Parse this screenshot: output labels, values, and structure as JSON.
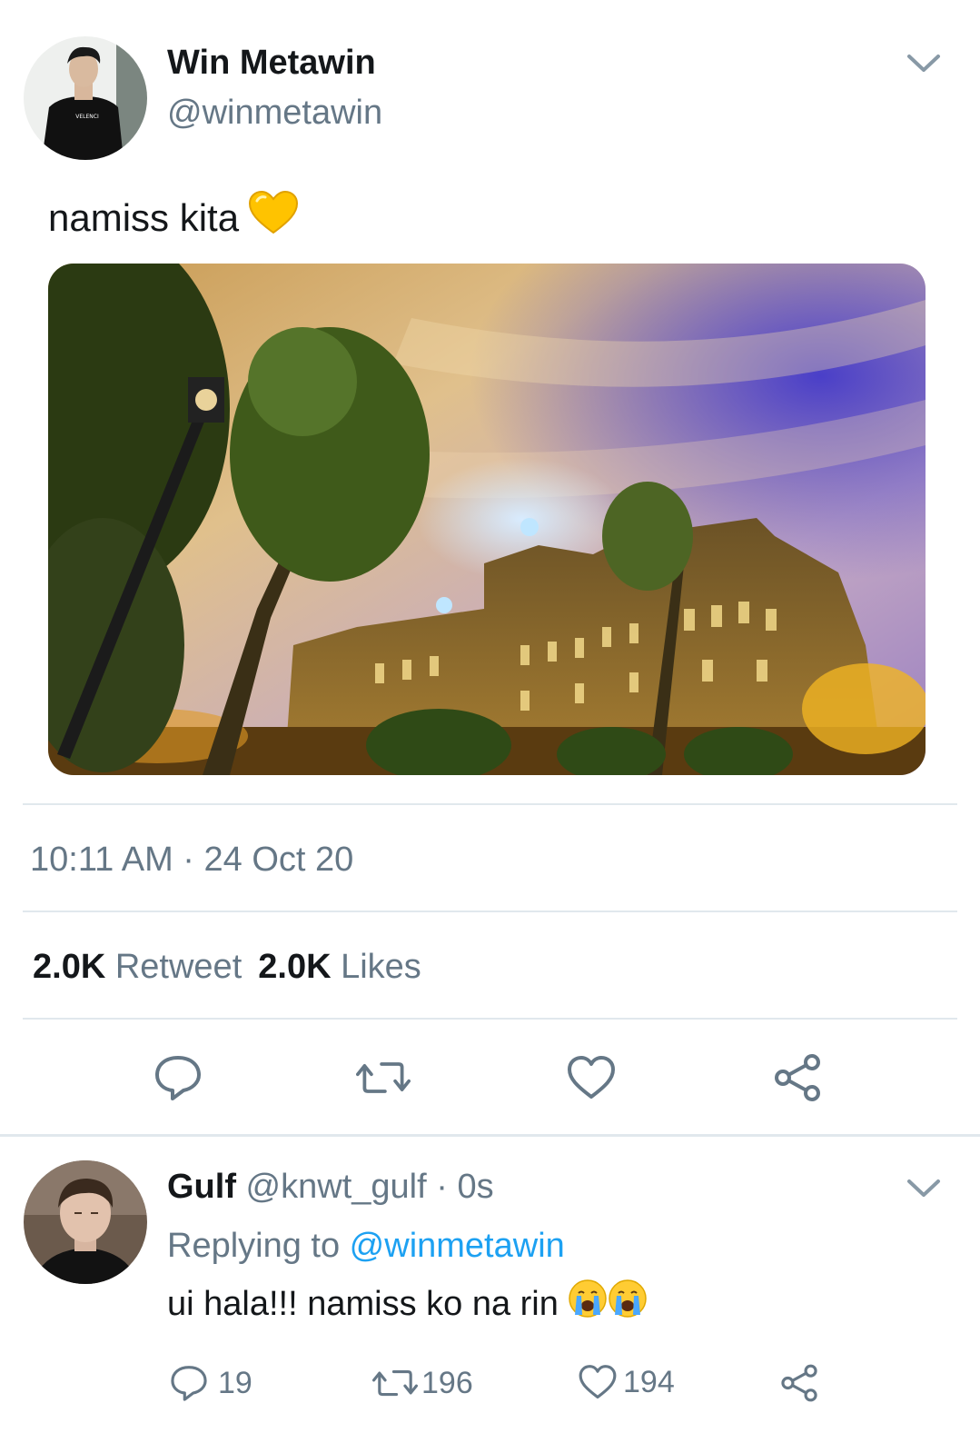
{
  "tweet": {
    "author_name": "Win Metawin",
    "author_handle": "@winmetawin",
    "text": "namiss kita",
    "timestamp": "10:11 AM · 24 Oct 20",
    "retweet_count": "2.0K",
    "retweet_label": "Retweet",
    "like_count": "2.0K",
    "like_label": "Likes",
    "avatar_shirt_text": "VELENCI"
  },
  "reply": {
    "author_name": "Gulf",
    "author_handle": "@knwt_gulf",
    "time": " · 0s",
    "replying_prefix": "Replying to ",
    "replying_to": "@winmetawin",
    "text": "ui hala!!! namiss ko na rin",
    "reply_count": "19",
    "retweet_count": "196",
    "like_count": "194"
  },
  "colors": {
    "secondary_text": "#657786",
    "link": "#1da1f2",
    "divider": "#e1e8ed"
  }
}
